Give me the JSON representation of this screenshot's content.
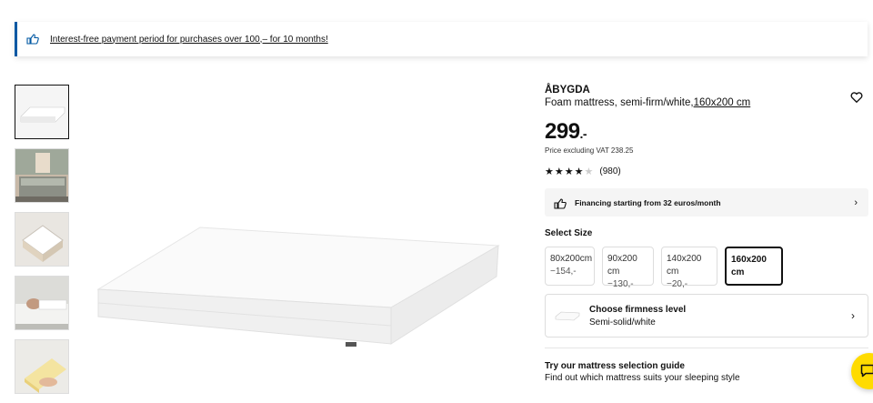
{
  "banner": {
    "text": "Interest-free payment period for purchases over 100,– for 10 months!",
    "icon": "thumbs-up-icon"
  },
  "gallery": {
    "thumbnails": [
      {
        "name": "mattress-thumb",
        "active": true
      },
      {
        "name": "bedroom-thumb",
        "active": false
      },
      {
        "name": "layers-thumb",
        "active": false
      },
      {
        "name": "sleeping-person-thumb",
        "active": false
      },
      {
        "name": "foam-detail-thumb",
        "active": false
      }
    ]
  },
  "product": {
    "brand": "ÅBYGDA",
    "subtitle_prefix": "Foam mattress, semi-firm/white,",
    "subtitle_size": "160x200 cm",
    "price": "299",
    "price_suffix": ".-",
    "vat": "Price excluding VAT 238.25",
    "rating": 4,
    "rating_max": 5,
    "review_count": "(980)"
  },
  "financing": {
    "text": "Financing starting from 32 euros/month"
  },
  "size_select": {
    "label": "Select Size",
    "options": [
      {
        "size": "80x200cm",
        "price": "−154,-",
        "selected": false
      },
      {
        "size": "90x200 cm",
        "price": "−130,-",
        "selected": false
      },
      {
        "size": "140x200 cm",
        "price": "−20,-",
        "selected": false
      },
      {
        "size": "160x200 cm",
        "price": "",
        "selected": true
      }
    ]
  },
  "firmness": {
    "title": "Choose firmness level",
    "value": "Semi-solid/white"
  },
  "guide": {
    "title": "Try our mattress selection guide",
    "subtitle": "Find out which mattress suits your sleeping style"
  },
  "colors": {
    "accent": "#0058a3",
    "chat": "#ffdb00"
  }
}
